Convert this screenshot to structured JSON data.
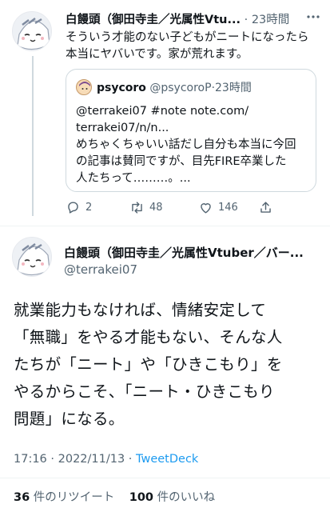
{
  "reply": {
    "author": "白饅頭（御田寺圭／光属性Vtu...",
    "separator": "·",
    "time": "23時間",
    "text_line1": "そういう才能のない子どもがニートになったら",
    "text_line2": "本当にヤバいです。家が荒れます。"
  },
  "quote": {
    "author": "psycoro",
    "handle": "@psycoroP",
    "separator": "·",
    "time": "23時間",
    "line1": "@terrakei07 #note note.com/",
    "line2": "terrakei07/n/n...",
    "line3": "めちゃくちゃいい話だし自分も本当に今回",
    "line4": "の記事は賛同ですが、目先FIRE卒業した",
    "line5": "人たちって………。..."
  },
  "actions": {
    "replies": "2",
    "retweets": "48",
    "likes": "146"
  },
  "main": {
    "author": "白饅頭（御田寺圭／光属性Vtuber／バー...",
    "handle": "@terrakei07",
    "line1": "就業能力もなければ、情緒安定して",
    "line2": "「無職」をやる才能もない、そんな人",
    "line3": "たちが「ニート」や「ひきこもり」を",
    "line4": "やるからこそ、「ニート・ひきこもり",
    "line5": "問題」になる。",
    "timestamp": "17:16 · 2022/11/13 · ",
    "via": "TweetDeck",
    "retweet_count": "36",
    "retweet_label": "件のリツイート",
    "like_count": "100",
    "like_label": "件のいいね"
  },
  "icons": [
    "reply-icon",
    "retweet-icon",
    "like-icon",
    "share-icon",
    "more-icon"
  ],
  "colors": {
    "link": "#1d9bf0",
    "muted": "#536471",
    "text": "#0f1419",
    "line": "#cfd9de"
  }
}
